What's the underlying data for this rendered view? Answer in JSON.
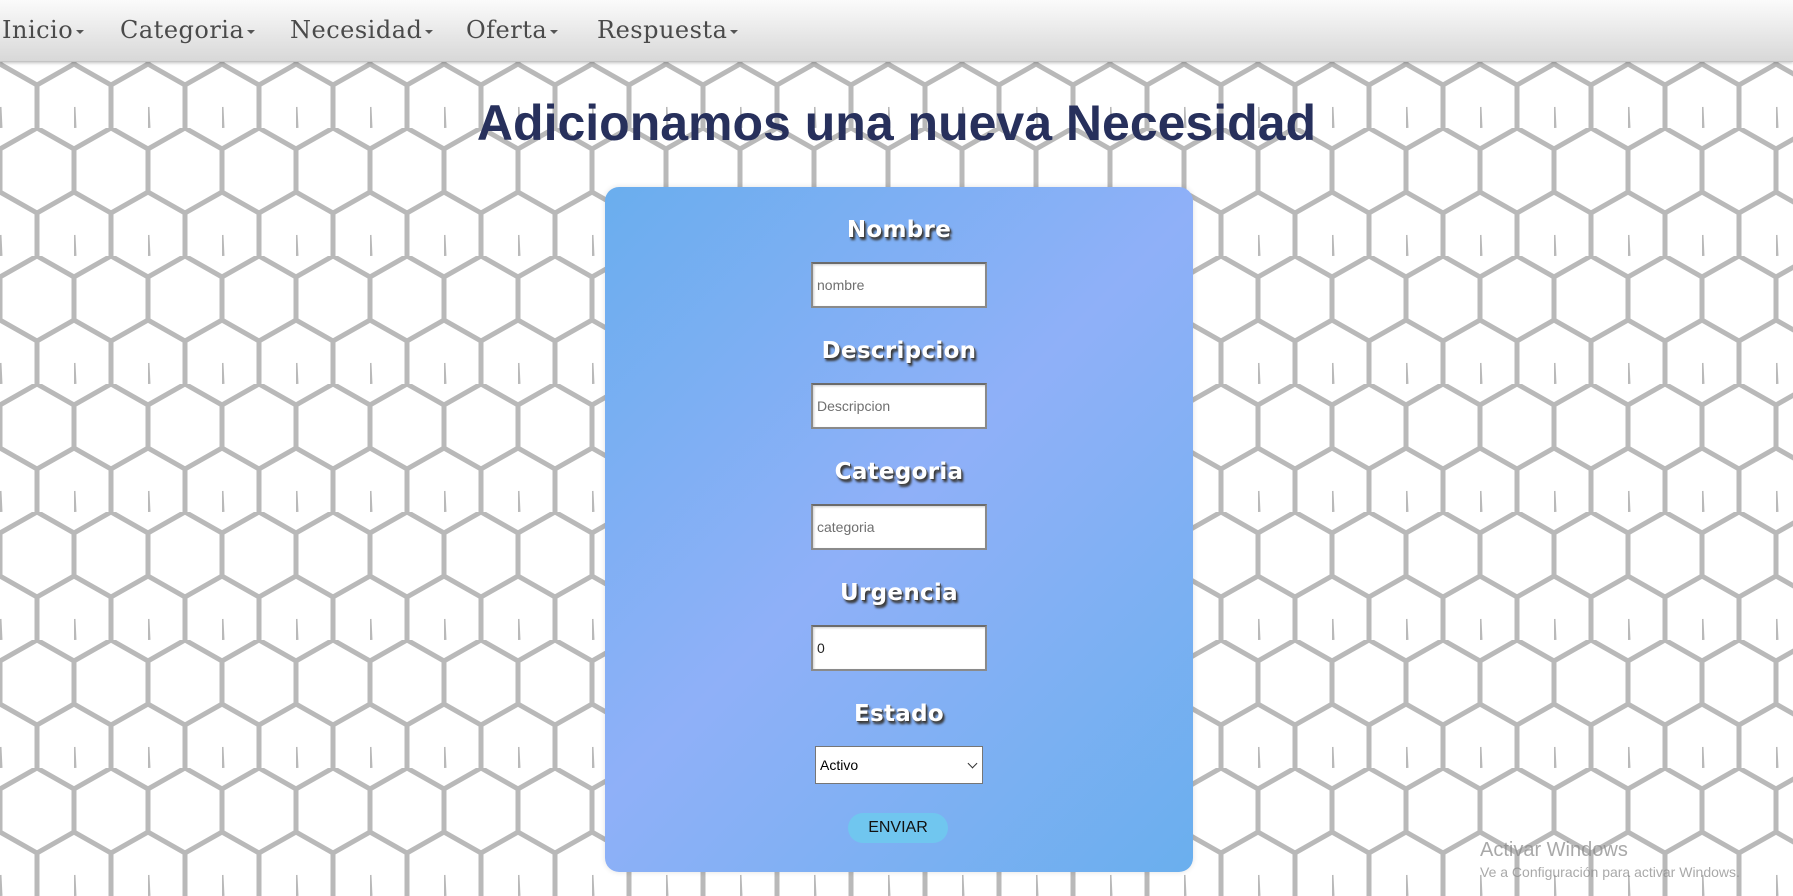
{
  "nav": {
    "items": [
      {
        "label": "Inicio"
      },
      {
        "label": "Categoria"
      },
      {
        "label": "Necesidad"
      },
      {
        "label": "Oferta"
      },
      {
        "label": "Respuesta"
      }
    ]
  },
  "page": {
    "title": "Adicionamos una nueva Necesidad"
  },
  "form": {
    "nombre": {
      "label": "Nombre",
      "placeholder": "nombre",
      "value": ""
    },
    "descripcion": {
      "label": "Descripcion",
      "placeholder": "Descripcion",
      "value": ""
    },
    "categoria": {
      "label": "Categoria",
      "placeholder": "categoria",
      "value": ""
    },
    "urgencia": {
      "label": "Urgencia",
      "value": "0"
    },
    "estado": {
      "label": "Estado",
      "selected": "Activo"
    },
    "submit_label": "ENVIAR"
  },
  "watermark": {
    "title": "Activar Windows",
    "subtitle": "Ve a Configuración para activar Windows."
  },
  "colors": {
    "title": "#27305c",
    "card_gradient_start": "#6aaeee",
    "card_gradient_mid": "#8fb0f8",
    "button": "#70c6ef"
  }
}
